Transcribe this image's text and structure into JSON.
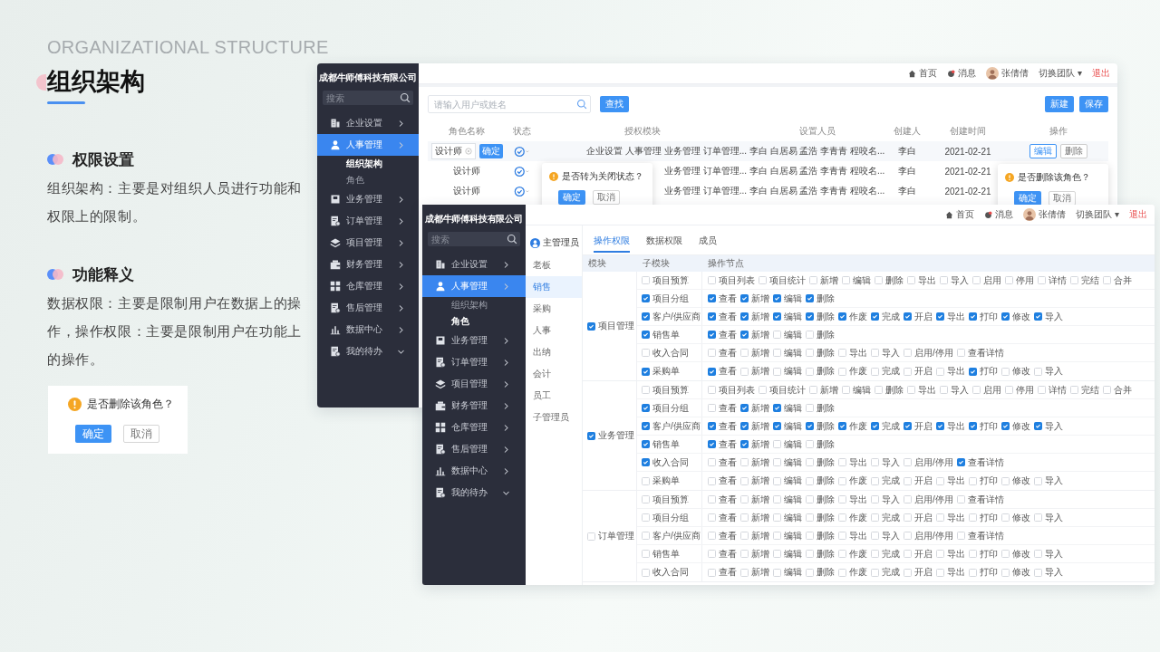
{
  "slide": {
    "eyebrow": "ORGANIZATIONAL STRUCTURE",
    "title": "组织架构",
    "sections": [
      {
        "heading": "权限设置",
        "body": "组织架构：主要是对组织人员进行功能和权限上的限制。"
      },
      {
        "heading": "功能释义",
        "body": "数据权限：主要是限制用户在数据上的操作，操作权限：主要是限制用户在功能上的操作。"
      }
    ],
    "popconfirm": {
      "message": "是否删除该角色？",
      "confirm": "确定",
      "cancel": "取消"
    }
  },
  "role_window": {
    "company": "成都牛师傅科技有限公司",
    "search_placeholder": "搜索",
    "menu": [
      {
        "label": "企业设置",
        "selected": false,
        "expanded": false
      },
      {
        "label": "人事管理",
        "selected": true,
        "expanded": false,
        "children": [
          {
            "label": "组织架构",
            "selected": true
          },
          {
            "label": "角色",
            "selected": false
          }
        ]
      },
      {
        "label": "业务管理",
        "selected": false,
        "expanded": false
      },
      {
        "label": "订单管理",
        "selected": false,
        "expanded": false
      },
      {
        "label": "项目管理",
        "selected": false,
        "expanded": false
      },
      {
        "label": "财务管理",
        "selected": false,
        "expanded": false
      },
      {
        "label": "仓库管理",
        "selected": false,
        "expanded": false
      },
      {
        "label": "售后管理",
        "selected": false,
        "expanded": false
      },
      {
        "label": "数据中心",
        "selected": false,
        "expanded": false
      },
      {
        "label": "我的待办",
        "selected": false,
        "expanded": true
      }
    ],
    "topbar": {
      "home": "首页",
      "messages": "消息",
      "user": "张倩倩",
      "team": "切换团队 ▾",
      "logout": "退出"
    },
    "filter_placeholder": "请输入用户或姓名",
    "find_button": "查找",
    "buttons": [
      "新建",
      "保存"
    ],
    "edit_confirm": "确定",
    "columns": [
      "角色名称",
      "状态",
      "授权模块",
      "设置人员",
      "创建人",
      "创建时间",
      "操作"
    ],
    "rows": [
      {
        "name": "设计师",
        "editing": true,
        "enabled": true,
        "modules": "企业设置 人事管理 业务管理 订单管理...",
        "members": "李白 白居易 孟浩 李青青 程咬名...",
        "creator": "李白",
        "date": "2021-02-21",
        "actions": [
          "编辑",
          "删除"
        ]
      },
      {
        "name": "设计师",
        "editing": false,
        "enabled": true,
        "modules": "业务管理 订单管理...",
        "members": "李白 白居易 孟浩 李青青 程咬名...",
        "creator": "李白",
        "date": "2021-02-21"
      },
      {
        "name": "设计师",
        "editing": false,
        "enabled": true,
        "modules": "业务管理 订单管理...",
        "members": "李白 白居易 孟浩 李青青 程咬名...",
        "creator": "李白",
        "date": "2021-02-21"
      }
    ],
    "status_popconfirm": {
      "message": "是否转为关闭状态？",
      "confirm": "确定",
      "cancel": "取消"
    },
    "delete_popconfirm": {
      "message": "是否删除该角色？",
      "confirm": "确定",
      "cancel": "取消"
    }
  },
  "permission_window": {
    "company": "成都牛师傅科技有限公司",
    "search_placeholder": "搜索",
    "menu": [
      {
        "label": "企业设置",
        "selected": false,
        "expanded": false
      },
      {
        "label": "人事管理",
        "selected": true,
        "expanded": false,
        "children": [
          {
            "label": "组织架构",
            "selected": false
          },
          {
            "label": "角色",
            "selected": true
          }
        ]
      },
      {
        "label": "业务管理",
        "selected": false,
        "expanded": false
      },
      {
        "label": "订单管理",
        "selected": false,
        "expanded": false
      },
      {
        "label": "项目管理",
        "selected": false,
        "expanded": false
      },
      {
        "label": "财务管理",
        "selected": false,
        "expanded": false
      },
      {
        "label": "仓库管理",
        "selected": false,
        "expanded": false
      },
      {
        "label": "售后管理",
        "selected": false,
        "expanded": false
      },
      {
        "label": "数据中心",
        "selected": false,
        "expanded": false
      },
      {
        "label": "我的待办",
        "selected": false,
        "expanded": true
      }
    ],
    "topbar": {
      "home": "首页",
      "messages": "消息",
      "user": "张倩倩",
      "team": "切换团队 ▾",
      "logout": "退出"
    },
    "admin": "主管理员",
    "roles": [
      {
        "label": "老板",
        "selected": false
      },
      {
        "label": "销售",
        "selected": true
      },
      {
        "label": "采购",
        "selected": false
      },
      {
        "label": "人事",
        "selected": false
      },
      {
        "label": "出纳",
        "selected": false
      },
      {
        "label": "会计",
        "selected": false
      },
      {
        "label": "员工",
        "selected": false
      },
      {
        "label": "子管理员",
        "selected": false
      }
    ],
    "tabs": [
      {
        "label": "操作权限",
        "selected": true
      },
      {
        "label": "数据权限",
        "selected": false
      },
      {
        "label": "成员",
        "selected": false
      }
    ],
    "columns": [
      "模块",
      "子模块",
      "操作节点"
    ],
    "groups": [
      {
        "module": "项目管理",
        "checked": true,
        "subs": [
          {
            "name": "项目预算",
            "checked": false,
            "ops": [
              {
                "label": "项目列表",
                "checked": false
              },
              {
                "label": "项目统计",
                "checked": false
              },
              {
                "label": "新增",
                "checked": false
              },
              {
                "label": "编辑",
                "checked": false
              },
              {
                "label": "删除",
                "checked": false
              },
              {
                "label": "导出",
                "checked": false
              },
              {
                "label": "导入",
                "checked": false
              },
              {
                "label": "启用",
                "checked": false
              },
              {
                "label": "停用",
                "checked": false
              },
              {
                "label": "详情",
                "checked": false
              },
              {
                "label": "完结",
                "checked": false
              },
              {
                "label": "合并",
                "checked": false
              }
            ]
          },
          {
            "name": "项目分组",
            "checked": true,
            "ops": [
              {
                "label": "查看",
                "checked": true
              },
              {
                "label": "新增",
                "checked": true
              },
              {
                "label": "编辑",
                "checked": true
              },
              {
                "label": "删除",
                "checked": true
              }
            ]
          },
          {
            "name": "客户/供应商",
            "checked": true,
            "ops": [
              {
                "label": "查看",
                "checked": true
              },
              {
                "label": "新增",
                "checked": true
              },
              {
                "label": "编辑",
                "checked": true
              },
              {
                "label": "删除",
                "checked": true
              },
              {
                "label": "作废",
                "checked": true
              },
              {
                "label": "完成",
                "checked": true
              },
              {
                "label": "开启",
                "checked": true
              },
              {
                "label": "导出",
                "checked": true
              },
              {
                "label": "打印",
                "checked": true
              },
              {
                "label": "修改",
                "checked": true
              },
              {
                "label": "导入",
                "checked": true
              }
            ]
          },
          {
            "name": "销售单",
            "checked": true,
            "ops": [
              {
                "label": "查看",
                "checked": true
              },
              {
                "label": "新增",
                "checked": true
              },
              {
                "label": "编辑",
                "checked": false
              },
              {
                "label": "删除",
                "checked": false
              }
            ]
          },
          {
            "name": "收入合同",
            "checked": false,
            "ops": [
              {
                "label": "查看",
                "checked": false
              },
              {
                "label": "新增",
                "checked": false
              },
              {
                "label": "编辑",
                "checked": false
              },
              {
                "label": "删除",
                "checked": false
              },
              {
                "label": "导出",
                "checked": false
              },
              {
                "label": "导入",
                "checked": false
              },
              {
                "label": "启用/停用",
                "checked": false
              },
              {
                "label": "查看详情",
                "checked": false
              }
            ]
          },
          {
            "name": "采购单",
            "checked": true,
            "ops": [
              {
                "label": "查看",
                "checked": true
              },
              {
                "label": "新增",
                "checked": false
              },
              {
                "label": "编辑",
                "checked": false
              },
              {
                "label": "删除",
                "checked": false
              },
              {
                "label": "作废",
                "checked": false
              },
              {
                "label": "完成",
                "checked": false
              },
              {
                "label": "开启",
                "checked": false
              },
              {
                "label": "导出",
                "checked": false
              },
              {
                "label": "打印",
                "checked": true
              },
              {
                "label": "修改",
                "checked": false
              },
              {
                "label": "导入",
                "checked": false
              }
            ]
          }
        ]
      },
      {
        "module": "业务管理",
        "checked": true,
        "subs": [
          {
            "name": "项目预算",
            "checked": false,
            "ops": [
              {
                "label": "项目列表",
                "checked": false
              },
              {
                "label": "项目统计",
                "checked": false
              },
              {
                "label": "新增",
                "checked": false
              },
              {
                "label": "编辑",
                "checked": false
              },
              {
                "label": "删除",
                "checked": false
              },
              {
                "label": "导出",
                "checked": false
              },
              {
                "label": "导入",
                "checked": false
              },
              {
                "label": "启用",
                "checked": false
              },
              {
                "label": "停用",
                "checked": false
              },
              {
                "label": "详情",
                "checked": false
              },
              {
                "label": "完结",
                "checked": false
              },
              {
                "label": "合并",
                "checked": false
              }
            ]
          },
          {
            "name": "项目分组",
            "checked": true,
            "ops": [
              {
                "label": "查看",
                "checked": false
              },
              {
                "label": "新增",
                "checked": true
              },
              {
                "label": "编辑",
                "checked": true
              },
              {
                "label": "删除",
                "checked": false
              }
            ]
          },
          {
            "name": "客户/供应商",
            "checked": true,
            "ops": [
              {
                "label": "查看",
                "checked": true
              },
              {
                "label": "新增",
                "checked": true
              },
              {
                "label": "编辑",
                "checked": true
              },
              {
                "label": "删除",
                "checked": true
              },
              {
                "label": "作废",
                "checked": true
              },
              {
                "label": "完成",
                "checked": true
              },
              {
                "label": "开启",
                "checked": true
              },
              {
                "label": "导出",
                "checked": true
              },
              {
                "label": "打印",
                "checked": true
              },
              {
                "label": "修改",
                "checked": true
              },
              {
                "label": "导入",
                "checked": true
              }
            ]
          },
          {
            "name": "销售单",
            "checked": true,
            "ops": [
              {
                "label": "查看",
                "checked": true
              },
              {
                "label": "新增",
                "checked": true
              },
              {
                "label": "编辑",
                "checked": false
              },
              {
                "label": "删除",
                "checked": false
              }
            ]
          },
          {
            "name": "收入合同",
            "checked": true,
            "ops": [
              {
                "label": "查看",
                "checked": false
              },
              {
                "label": "新增",
                "checked": false
              },
              {
                "label": "编辑",
                "checked": false
              },
              {
                "label": "删除",
                "checked": false
              },
              {
                "label": "导出",
                "checked": false
              },
              {
                "label": "导入",
                "checked": false
              },
              {
                "label": "启用/停用",
                "checked": false
              },
              {
                "label": "查看详情",
                "checked": true
              }
            ]
          },
          {
            "name": "采购单",
            "checked": false,
            "ops": [
              {
                "label": "查看",
                "checked": false
              },
              {
                "label": "新增",
                "checked": false
              },
              {
                "label": "编辑",
                "checked": false
              },
              {
                "label": "删除",
                "checked": false
              },
              {
                "label": "作废",
                "checked": false
              },
              {
                "label": "完成",
                "checked": false
              },
              {
                "label": "开启",
                "checked": false
              },
              {
                "label": "导出",
                "checked": false
              },
              {
                "label": "打印",
                "checked": false
              },
              {
                "label": "修改",
                "checked": false
              },
              {
                "label": "导入",
                "checked": false
              }
            ]
          }
        ]
      },
      {
        "module": "订单管理",
        "checked": false,
        "subs": [
          {
            "name": "项目预算",
            "checked": false,
            "ops": [
              {
                "label": "查看",
                "checked": false
              },
              {
                "label": "新增",
                "checked": false
              },
              {
                "label": "编辑",
                "checked": false
              },
              {
                "label": "删除",
                "checked": false
              },
              {
                "label": "导出",
                "checked": false
              },
              {
                "label": "导入",
                "checked": false
              },
              {
                "label": "启用/停用",
                "checked": false
              },
              {
                "label": "查看详情",
                "checked": false
              }
            ]
          },
          {
            "name": "项目分组",
            "checked": false,
            "ops": [
              {
                "label": "查看",
                "checked": false
              },
              {
                "label": "新增",
                "checked": false
              },
              {
                "label": "编辑",
                "checked": false
              },
              {
                "label": "删除",
                "checked": false
              },
              {
                "label": "作废",
                "checked": false
              },
              {
                "label": "完成",
                "checked": false
              },
              {
                "label": "开启",
                "checked": false
              },
              {
                "label": "导出",
                "checked": false
              },
              {
                "label": "打印",
                "checked": false
              },
              {
                "label": "修改",
                "checked": false
              },
              {
                "label": "导入",
                "checked": false
              }
            ]
          },
          {
            "name": "客户/供应商",
            "checked": false,
            "ops": [
              {
                "label": "查看",
                "checked": false
              },
              {
                "label": "新增",
                "checked": false
              },
              {
                "label": "编辑",
                "checked": false
              },
              {
                "label": "删除",
                "checked": false
              },
              {
                "label": "导出",
                "checked": false
              },
              {
                "label": "导入",
                "checked": false
              },
              {
                "label": "启用/停用",
                "checked": false
              },
              {
                "label": "查看详情",
                "checked": false
              }
            ]
          },
          {
            "name": "销售单",
            "checked": false,
            "ops": [
              {
                "label": "查看",
                "checked": false
              },
              {
                "label": "新增",
                "checked": false
              },
              {
                "label": "编辑",
                "checked": false
              },
              {
                "label": "删除",
                "checked": false
              },
              {
                "label": "作废",
                "checked": false
              },
              {
                "label": "完成",
                "checked": false
              },
              {
                "label": "开启",
                "checked": false
              },
              {
                "label": "导出",
                "checked": false
              },
              {
                "label": "打印",
                "checked": false
              },
              {
                "label": "修改",
                "checked": false
              },
              {
                "label": "导入",
                "checked": false
              }
            ]
          },
          {
            "name": "收入合同",
            "checked": false,
            "ops": [
              {
                "label": "查看",
                "checked": false
              },
              {
                "label": "新增",
                "checked": false
              },
              {
                "label": "编辑",
                "checked": false
              },
              {
                "label": "删除",
                "checked": false
              },
              {
                "label": "作废",
                "checked": false
              },
              {
                "label": "完成",
                "checked": false
              },
              {
                "label": "开启",
                "checked": false
              },
              {
                "label": "导出",
                "checked": false
              },
              {
                "label": "打印",
                "checked": false
              },
              {
                "label": "修改",
                "checked": false
              },
              {
                "label": "导入",
                "checked": false
              }
            ]
          }
        ]
      }
    ]
  }
}
